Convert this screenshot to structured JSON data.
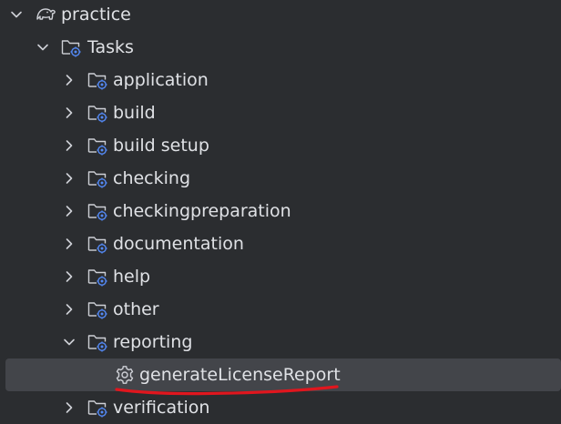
{
  "tree": {
    "root": {
      "label": "practice",
      "icon": "gradle-elephant-icon",
      "expanded": true
    },
    "tasks": {
      "label": "Tasks",
      "icon": "task-folder-icon",
      "expanded": true
    },
    "groups": [
      {
        "label": "application",
        "expanded": false
      },
      {
        "label": "build",
        "expanded": false
      },
      {
        "label": "build setup",
        "expanded": false
      },
      {
        "label": "checking",
        "expanded": false
      },
      {
        "label": "checkingpreparation",
        "expanded": false
      },
      {
        "label": "documentation",
        "expanded": false
      },
      {
        "label": "help",
        "expanded": false
      },
      {
        "label": "other",
        "expanded": false
      },
      {
        "label": "reporting",
        "expanded": true
      },
      {
        "label": "verification",
        "expanded": false
      }
    ],
    "task_item": {
      "label": "generateLicenseReport",
      "icon": "gear-icon",
      "selected": true
    }
  },
  "annotation": {
    "color": "#e0161e"
  },
  "colors": {
    "background": "#2b2d30",
    "selection": "#43454a",
    "text": "#dfe1e5",
    "icon_gray": "#ced0d6",
    "icon_blue": "#548af7"
  }
}
